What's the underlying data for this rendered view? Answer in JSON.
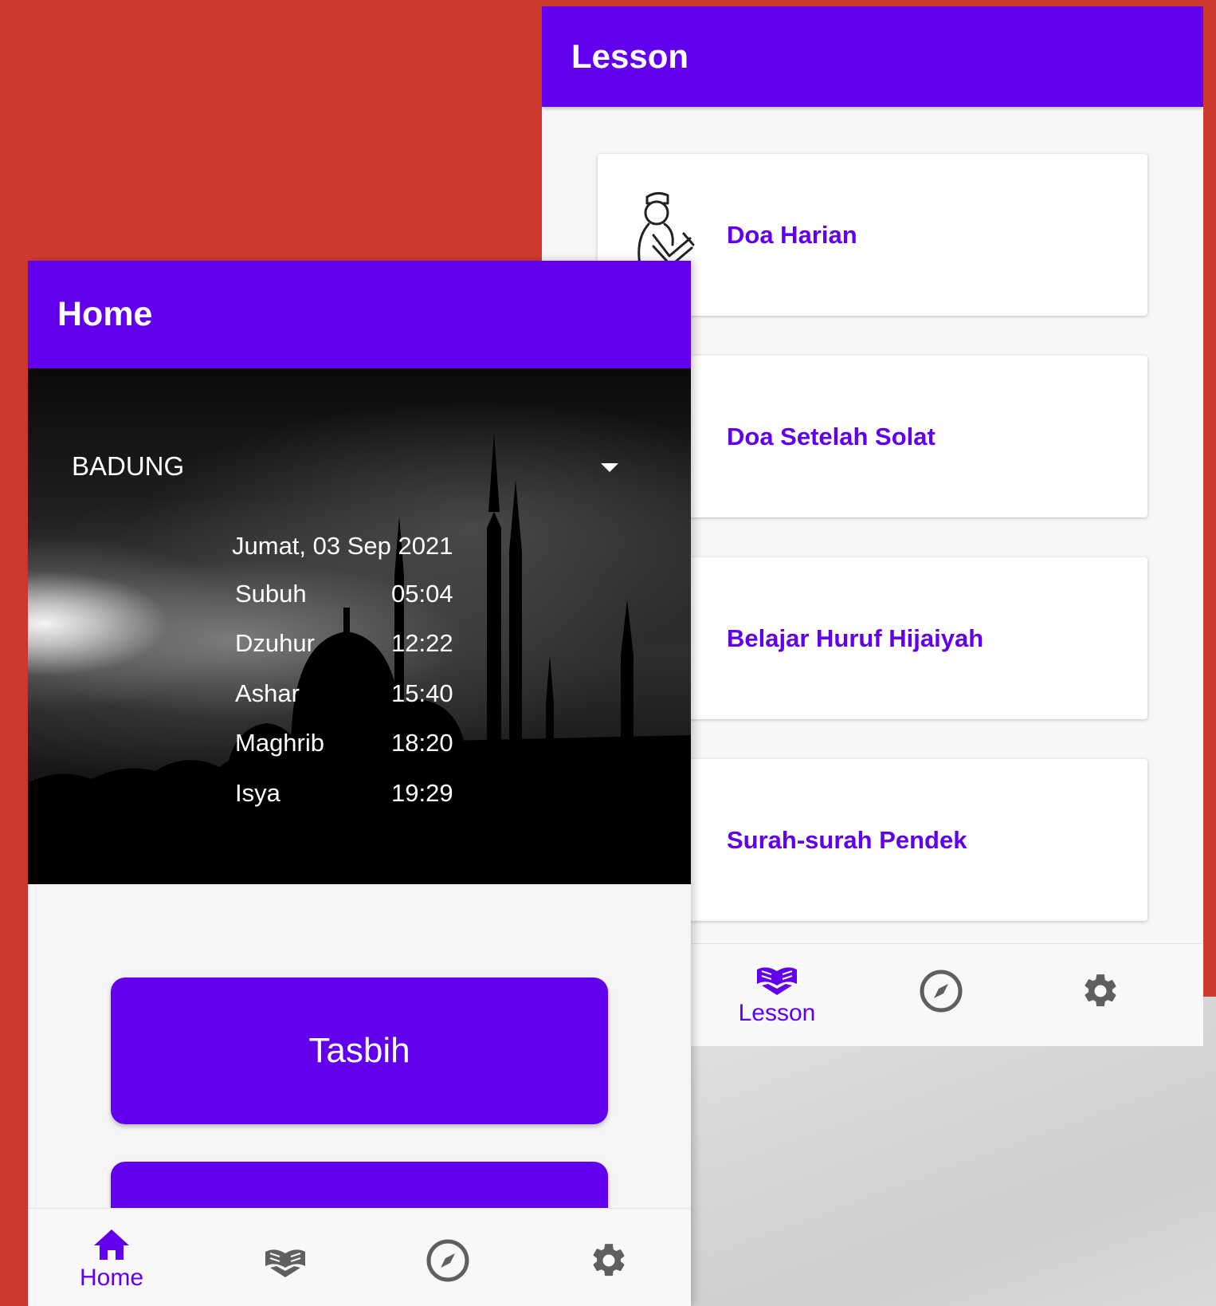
{
  "lesson_screen": {
    "title": "Lesson",
    "cards": [
      {
        "label": "Doa Harian",
        "icon": "praying-man-icon"
      },
      {
        "label": "Doa Setelah Solat"
      },
      {
        "label": "Belajar Huruf Hijaiyah"
      },
      {
        "label": "Surah-surah Pendek"
      }
    ],
    "bottom_nav": {
      "active_label": "Lesson",
      "items": [
        {
          "icon": "quran-icon",
          "label": "Lesson",
          "active": true
        },
        {
          "icon": "compass-icon"
        },
        {
          "icon": "gear-icon"
        }
      ]
    }
  },
  "home_screen": {
    "title": "Home",
    "city": "BADUNG",
    "date": "Jumat, 03 Sep 2021",
    "prayers": [
      {
        "name": "Subuh",
        "time": "05:04"
      },
      {
        "name": "Dzuhur",
        "time": "12:22"
      },
      {
        "name": "Ashar",
        "time": "15:40"
      },
      {
        "name": "Maghrib",
        "time": "18:20"
      },
      {
        "name": "Isya",
        "time": "19:29"
      }
    ],
    "buttons": [
      {
        "label": "Tasbih"
      },
      {
        "label": ""
      }
    ],
    "bottom_nav": {
      "items": [
        {
          "icon": "home-icon",
          "label": "Home",
          "active": true
        },
        {
          "icon": "quran-icon"
        },
        {
          "icon": "compass-icon"
        },
        {
          "icon": "gear-icon"
        }
      ]
    }
  },
  "colors": {
    "primary": "#6200ee",
    "background": "#cf3a30",
    "inactive_icon": "#5f5f5f"
  }
}
